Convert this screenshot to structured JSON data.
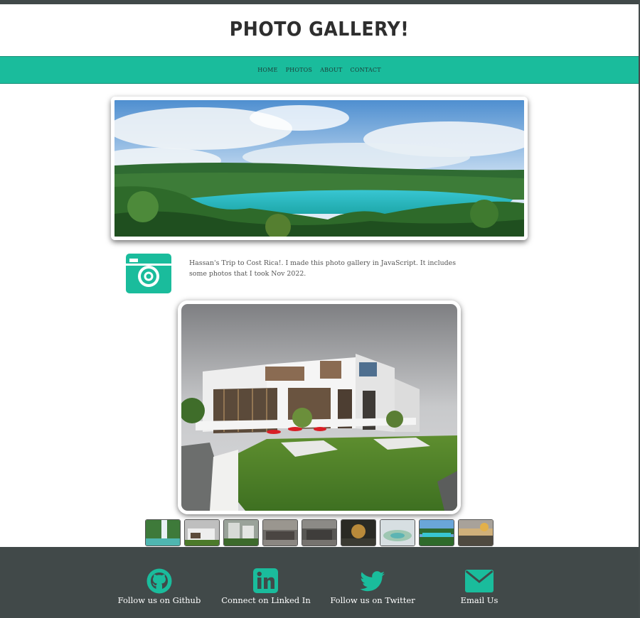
{
  "header": {
    "title": "PHOTO GALLERY!"
  },
  "nav": {
    "items": [
      "HOME",
      "PHOTOS",
      "ABOUT",
      "CONTACT"
    ]
  },
  "intro": {
    "text": "Hassan's Trip to Cost Rica!. I made this photo gallery in JavaScript. It includes some photos that I took Nov 2022."
  },
  "gallery": {
    "thumbnail_count": 9,
    "selected_index": 1
  },
  "footer": {
    "links": [
      {
        "icon": "github-icon",
        "label": "Follow us on Github"
      },
      {
        "icon": "linkedin-icon",
        "label": "Connect on Linked In"
      },
      {
        "icon": "twitter-icon",
        "label": "Follow us on Twitter"
      },
      {
        "icon": "email-icon",
        "label": "Email Us"
      }
    ]
  },
  "colors": {
    "accent": "#1abc9c",
    "footer_bg": "#414949",
    "title": "#2e2e2e"
  }
}
